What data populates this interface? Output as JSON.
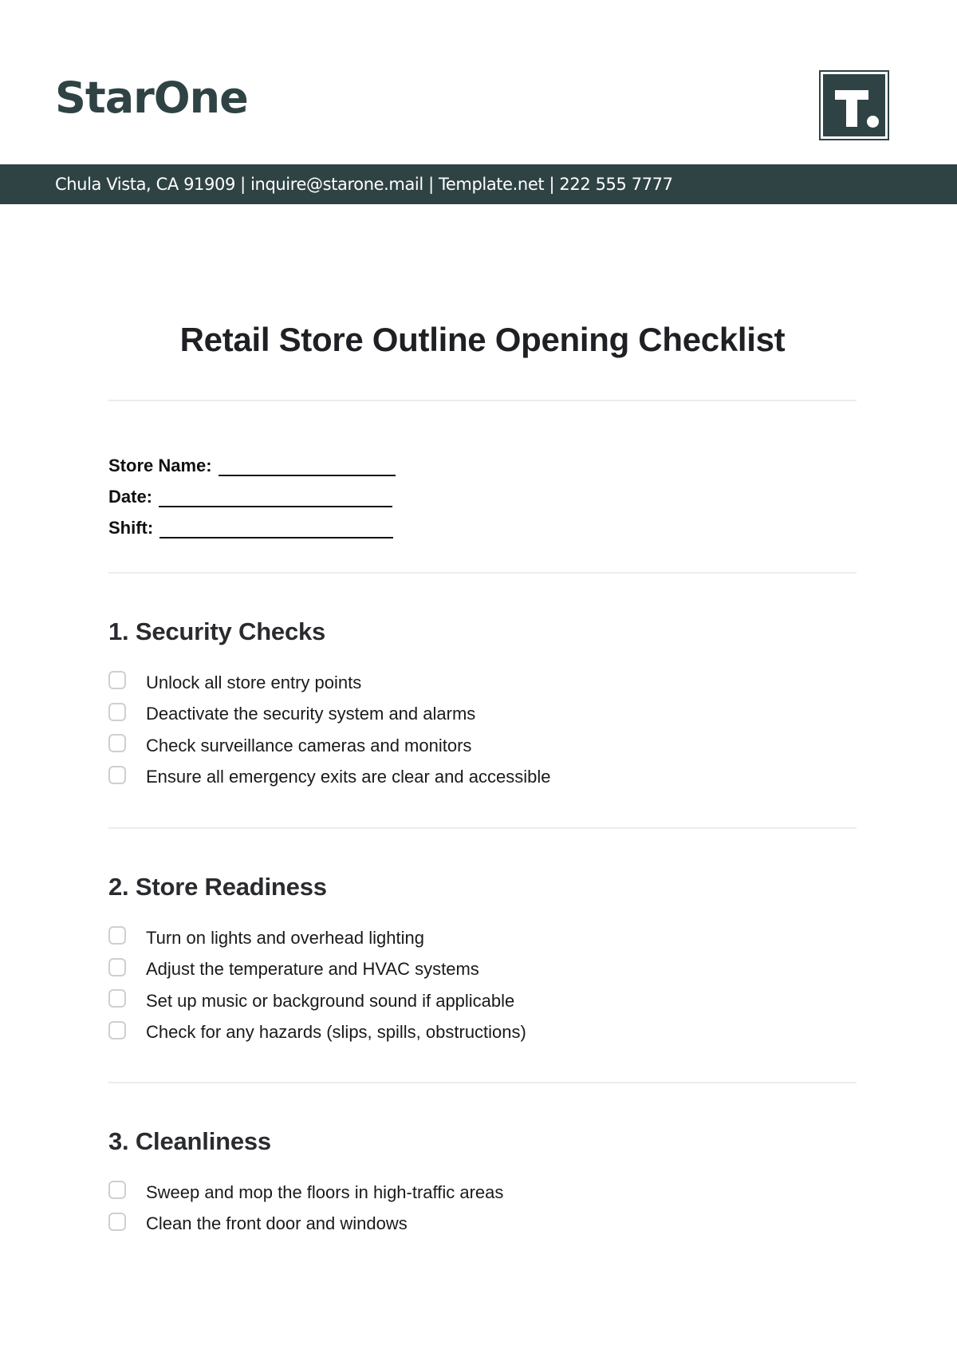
{
  "header": {
    "brand_name": "StarOne",
    "logo_letter": "T.",
    "contact_line": "Chula Vista, CA 91909 | inquire@starone.mail | Template.net | 222 555 7777"
  },
  "document": {
    "title": "Retail Store Outline Opening Checklist",
    "fields": [
      {
        "label": "Store Name:",
        "value": ""
      },
      {
        "label": "Date:",
        "value": ""
      },
      {
        "label": "Shift:",
        "value": ""
      }
    ],
    "sections": [
      {
        "heading": "1. Security Checks",
        "items": [
          {
            "label": "Unlock all store entry points",
            "checked": false
          },
          {
            "label": "Deactivate the security system and alarms",
            "checked": false
          },
          {
            "label": "Check surveillance cameras and monitors",
            "checked": false
          },
          {
            "label": "Ensure all emergency exits are clear and accessible",
            "checked": false
          }
        ]
      },
      {
        "heading": "2. Store Readiness",
        "items": [
          {
            "label": "Turn on lights and overhead lighting",
            "checked": false
          },
          {
            "label": "Adjust the temperature and HVAC systems",
            "checked": false
          },
          {
            "label": "Set up music or background sound if applicable",
            "checked": false
          },
          {
            "label": "Check for any hazards (slips, spills, obstructions)",
            "checked": false
          }
        ]
      },
      {
        "heading": "3. Cleanliness",
        "items": [
          {
            "label": "Sweep and mop the floors in high-traffic areas",
            "checked": false
          },
          {
            "label": "Clean the front door and windows",
            "checked": false
          }
        ]
      }
    ]
  },
  "colors": {
    "brand": "#2f4345",
    "text": "#1f2024",
    "divider": "#ececec",
    "checkbox_border": "#cfcfcf"
  }
}
